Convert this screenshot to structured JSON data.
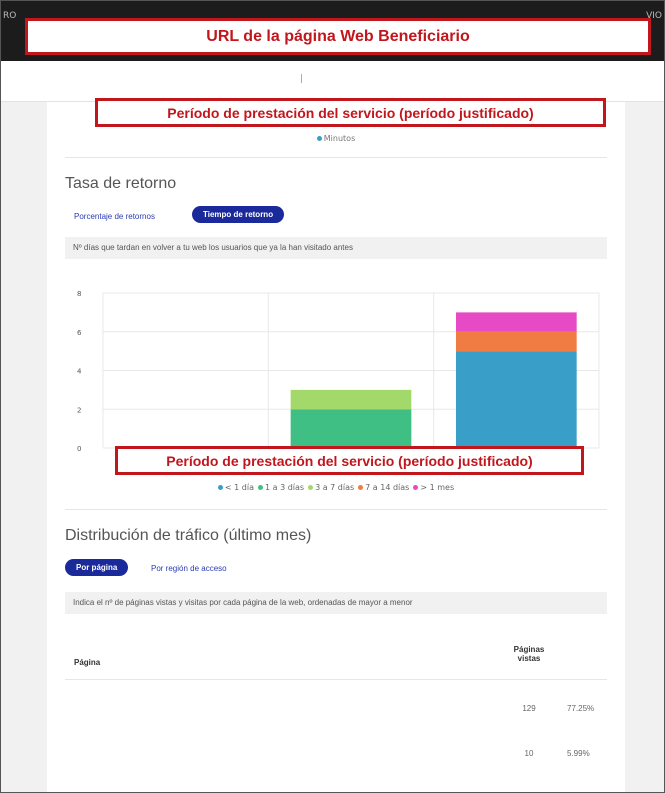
{
  "header": {
    "annotation_url": "URL de la página Web Beneficiario",
    "edge_left": "RO",
    "edge_right": "VIO"
  },
  "annotation_period": "Período de prestación del servicio (período justificado)",
  "minutes_legend": {
    "label": "Minutos",
    "color": "#3a9fc8"
  },
  "return_rate": {
    "title": "Tasa de retorno",
    "tabs": [
      {
        "label": "Porcentaje de retornos",
        "active": false
      },
      {
        "label": "Tiempo de retorno",
        "active": true
      }
    ],
    "description": "Nº días que tardan en volver a tu web los usuarios que ya la han visitado antes"
  },
  "chart_data": {
    "type": "bar",
    "stacked": true,
    "categories": [
      "",
      "",
      ""
    ],
    "series": [
      {
        "name": "< 1 día",
        "color": "#3a9fc8",
        "values": [
          0,
          0,
          5
        ]
      },
      {
        "name": "1 a 3 días",
        "color": "#3fbf84",
        "values": [
          0,
          2,
          0
        ]
      },
      {
        "name": "3 a 7 días",
        "color": "#a3d96a",
        "values": [
          0,
          1,
          0
        ]
      },
      {
        "name": "7 a 14 días",
        "color": "#f07c44",
        "values": [
          0,
          0,
          1
        ]
      },
      {
        "name": "> 1 mes",
        "color": "#e64ac5",
        "values": [
          0,
          0,
          1
        ]
      }
    ],
    "ylim": [
      0,
      8
    ],
    "yticks": [
      "0",
      "2",
      "4",
      "6",
      "8"
    ],
    "grid": true,
    "legend_position": "bottom"
  },
  "traffic": {
    "title": "Distribución de tráfico (último mes)",
    "tabs": [
      {
        "label": "Por página",
        "active": true
      },
      {
        "label": "Por región de acceso",
        "active": false
      }
    ],
    "description": "Indica el nº de páginas vistas y visitas por cada página de la web, ordenadas de mayor a menor",
    "columns": {
      "page": "Página",
      "views_line1": "Páginas",
      "views_line2": "vistas"
    },
    "rows": [
      {
        "page": "",
        "views": "129",
        "percent": "77.25%"
      },
      {
        "page": "",
        "views": "10",
        "percent": "5.99%"
      }
    ]
  }
}
